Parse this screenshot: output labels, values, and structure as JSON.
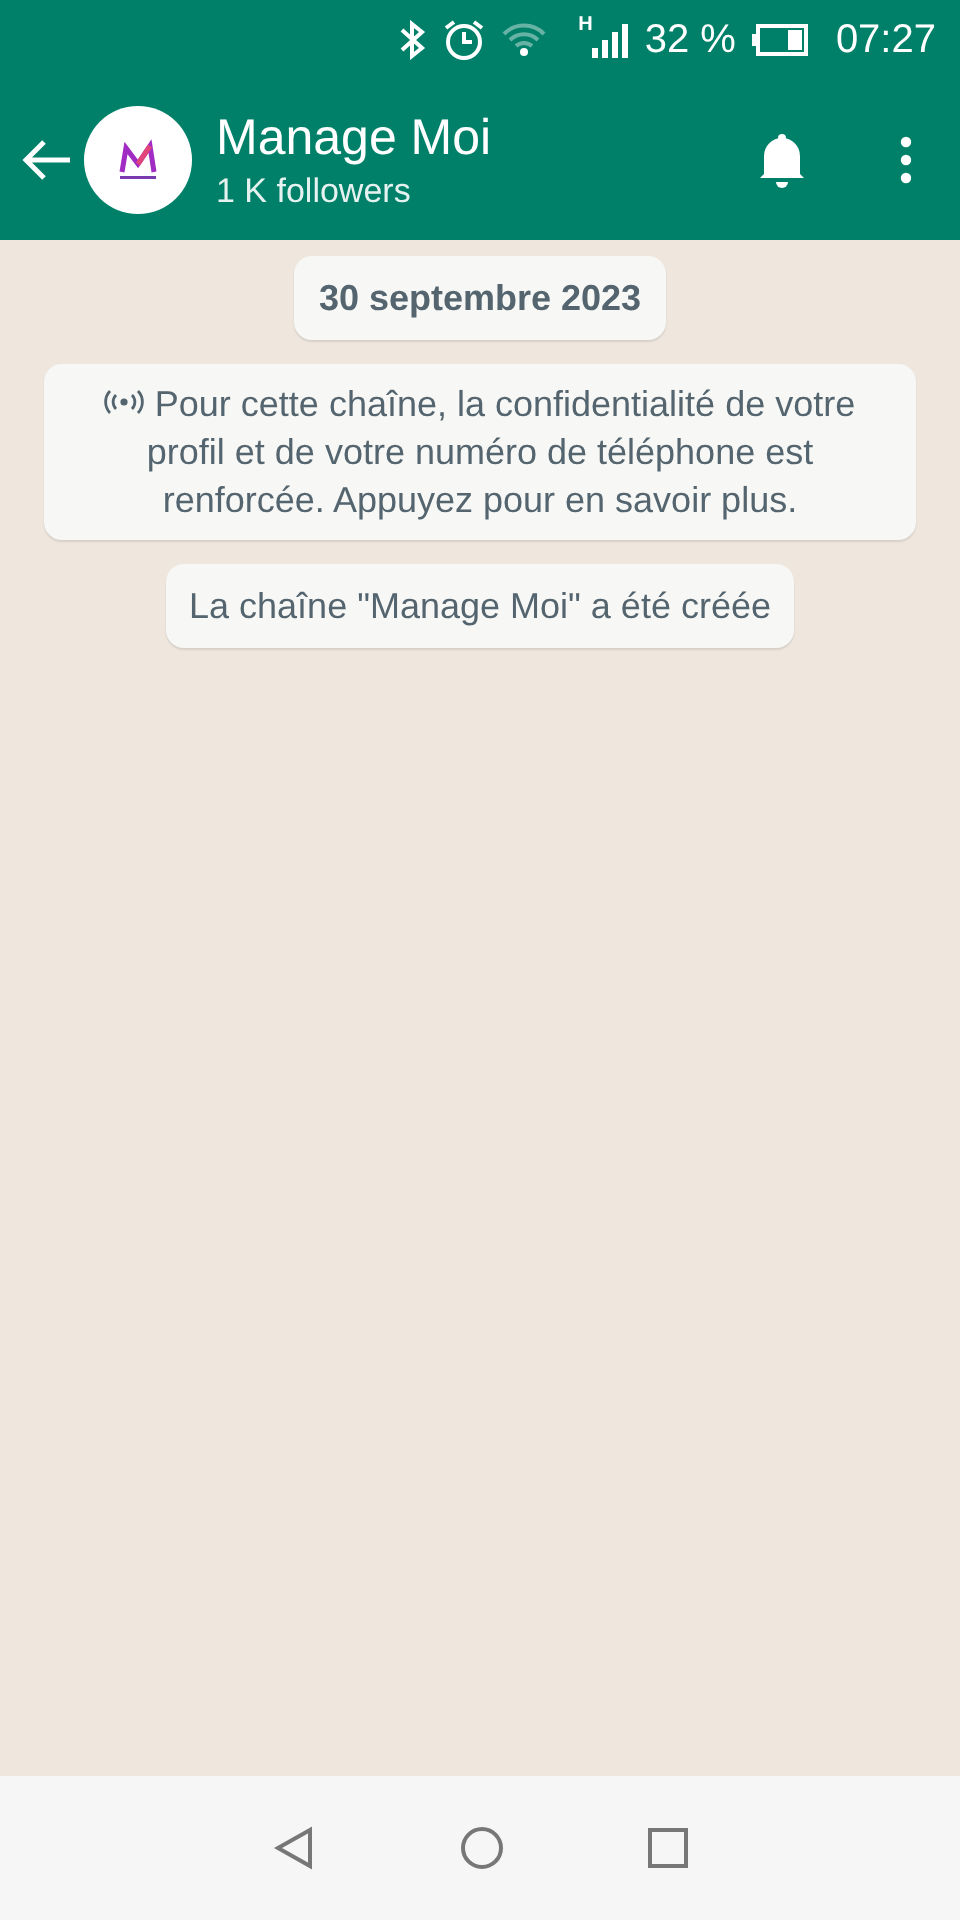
{
  "status_bar": {
    "network_type": "H",
    "battery": "32 %",
    "time": "07:27"
  },
  "header": {
    "title": "Manage Moi",
    "subtitle": "1 K followers"
  },
  "messages": [
    {
      "kind": "date",
      "text": "30 septembre 2023"
    },
    {
      "kind": "notice",
      "text": "Pour cette chaîne, la confidentialité de votre profil et de votre numéro de téléphone est renforcée. Appuyez pour en savoir plus."
    },
    {
      "kind": "system",
      "text": "La chaîne \"Manage Moi\" a été créée"
    }
  ]
}
